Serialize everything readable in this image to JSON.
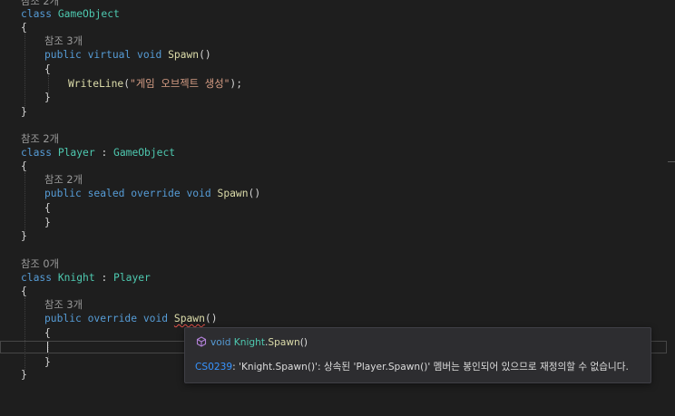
{
  "code": {
    "block1": {
      "lens": "참조 2개",
      "class_kw": "class",
      "class_name": "GameObject",
      "open_brace": "{",
      "method_lens": "참조 3개",
      "mod1": "public",
      "mod2": "virtual",
      "ret": "void",
      "method": "Spawn",
      "parens": "()",
      "body_open": "{",
      "call_fn": "WriteLine",
      "call_open": "(",
      "call_str": "\"게임 오브젝트 생성\"",
      "call_close": ");",
      "body_close": "}",
      "close_brace": "}"
    },
    "block2": {
      "lens": "참조 2개",
      "class_kw": "class",
      "class_name": "Player",
      "colon": " : ",
      "base": "GameObject",
      "open_brace": "{",
      "method_lens": "참조 2개",
      "mod1": "public",
      "mod2": "sealed",
      "mod3": "override",
      "ret": "void",
      "method": "Spawn",
      "parens": "()",
      "body_open": "{",
      "body_close": "}",
      "close_brace": "}"
    },
    "block3": {
      "lens": "참조 0개",
      "class_kw": "class",
      "class_name": "Knight",
      "colon": " : ",
      "base": "Player",
      "open_brace": "{",
      "method_lens": "참조 3개",
      "mod1": "public",
      "mod2": "override",
      "ret": "void",
      "method": "Spawn",
      "parens": "()",
      "body_open": "{",
      "body_close": "}",
      "close_brace": "}"
    }
  },
  "tooltip": {
    "icon": "cube-method-icon",
    "sig_ret": "void",
    "sig_class": "Knight",
    "sig_dot": ".",
    "sig_method": "Spawn",
    "sig_parens": "()",
    "error_code": "CS0239",
    "error_message": ": 'Knight.Spawn()': 상속된 'Player.Spawn()' 멤버는 봉인되어 있으므로 재정의할 수 없습니다."
  },
  "colors": {
    "background": "#1e1e1e",
    "keyword": "#569cd6",
    "type": "#4ec9b0",
    "method": "#dcdcaa",
    "string": "#d69d85",
    "codelens": "#999999",
    "error_link": "#3794ff",
    "squiggle": "#e5534b"
  }
}
